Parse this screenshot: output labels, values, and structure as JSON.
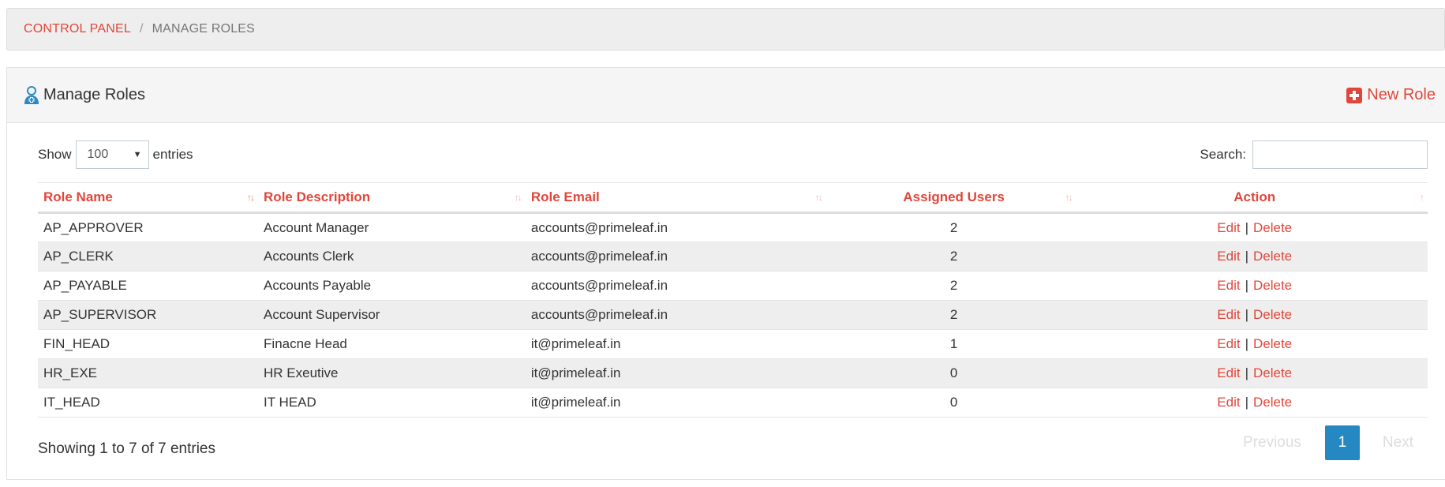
{
  "breadcrumb": {
    "root": "CONTROL PANEL",
    "separator": "/",
    "current": "MANAGE ROLES"
  },
  "portlet": {
    "title": "Manage Roles",
    "title_icon": "user-medical-icon",
    "new_button": "New Role",
    "new_icon": "plus-square-icon"
  },
  "controls": {
    "show_label": "Show",
    "page_size": "100",
    "entries_label": "entries",
    "search_label": "Search:",
    "search_value": "",
    "search_placeholder": ""
  },
  "table": {
    "headers": {
      "name": "Role Name",
      "description": "Role Description",
      "email": "Role Email",
      "users": "Assigned Users",
      "action": "Action"
    },
    "rows": [
      {
        "name": "AP_APPROVER",
        "description": "Account Manager",
        "email": "accounts@primeleaf.in",
        "users": "2",
        "edit": "Edit",
        "sep": "|",
        "delete": "Delete"
      },
      {
        "name": "AP_CLERK",
        "description": "Accounts Clerk",
        "email": "accounts@primeleaf.in",
        "users": "2",
        "edit": "Edit",
        "sep": "|",
        "delete": "Delete"
      },
      {
        "name": "AP_PAYABLE",
        "description": "Accounts Payable",
        "email": "accounts@primeleaf.in",
        "users": "2",
        "edit": "Edit",
        "sep": "|",
        "delete": "Delete"
      },
      {
        "name": "AP_SUPERVISOR",
        "description": "Account Supervisor",
        "email": "accounts@primeleaf.in",
        "users": "2",
        "edit": "Edit",
        "sep": "|",
        "delete": "Delete"
      },
      {
        "name": "FIN_HEAD",
        "description": "Finacne Head",
        "email": "it@primeleaf.in",
        "users": "1",
        "edit": "Edit",
        "sep": "|",
        "delete": "Delete"
      },
      {
        "name": "HR_EXE",
        "description": "HR Exeutive",
        "email": "it@primeleaf.in",
        "users": "0",
        "edit": "Edit",
        "sep": "|",
        "delete": "Delete"
      },
      {
        "name": "IT_HEAD",
        "description": "IT HEAD",
        "email": "it@primeleaf.in",
        "users": "0",
        "edit": "Edit",
        "sep": "|",
        "delete": "Delete"
      }
    ]
  },
  "footer": {
    "info": "Showing 1 to 7 of 7 entries",
    "previous": "Previous",
    "page": "1",
    "next": "Next"
  },
  "colors": {
    "accent": "#e1463a",
    "pager_active": "#2588c0",
    "icon_blue": "#2b8ac6"
  }
}
